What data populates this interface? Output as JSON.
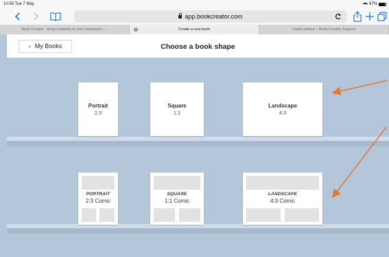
{
  "status_bar": {
    "time": "10:59  Tue 7 May",
    "battery": "87%"
  },
  "toolbar": {
    "url": "app.bookcreator.com",
    "back_icon": "chevron-left-icon",
    "forward_icon": "chevron-right-icon",
    "bookmarks_icon": "book-open-icon",
    "reload_icon": "reload-icon",
    "share_icon": "share-icon",
    "new_tab_icon": "plus-icon",
    "tabs_icon": "tabs-icon"
  },
  "tabs": [
    {
      "label": "Book Creator - bring creativity to your classroom -...",
      "active": false
    },
    {
      "label": "Create a new book",
      "active": true
    },
    {
      "label": "Useful advice – Book Creator Support",
      "active": false
    }
  ],
  "header": {
    "back_label": "My Books",
    "title": "Choose a book shape"
  },
  "shapes": [
    {
      "name": "Portrait",
      "ratio": "2:3"
    },
    {
      "name": "Square",
      "ratio": "1:1"
    },
    {
      "name": "Landscape",
      "ratio": "4:3"
    }
  ],
  "comics": [
    {
      "name": "PORTRAIT",
      "ratio": "2:3 Comic"
    },
    {
      "name": "SQUARE",
      "ratio": "1:1 Comic"
    },
    {
      "name": "LANDSCAPE",
      "ratio": "4:3 Comic"
    }
  ],
  "colors": {
    "accent": "#1a7cf0",
    "shelf_background": "#b4c6da",
    "annotation_arrow": "#e8772e"
  }
}
